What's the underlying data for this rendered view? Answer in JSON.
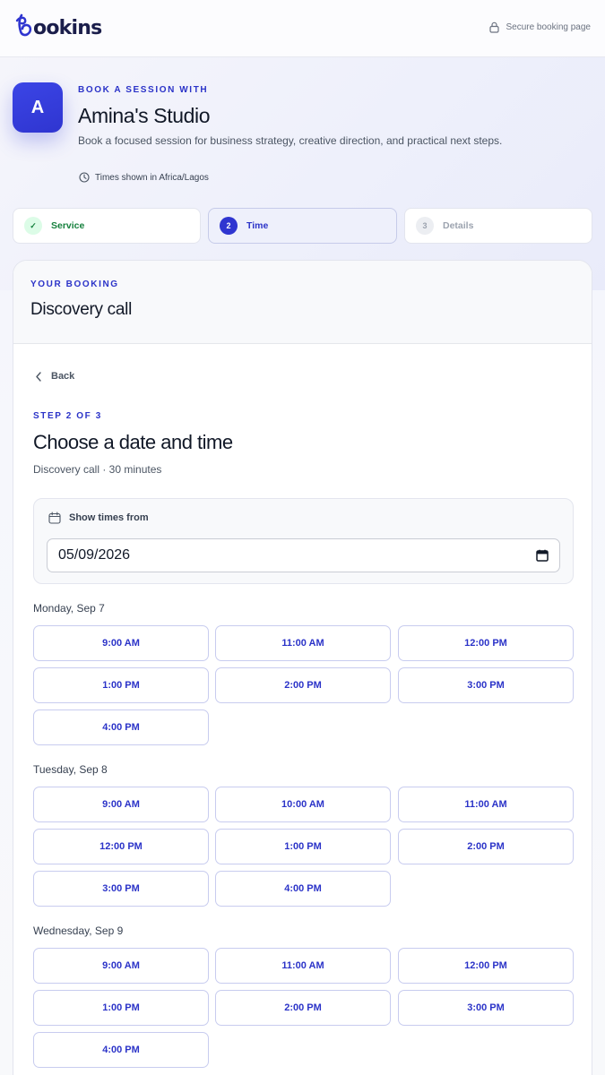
{
  "header": {
    "brand": "ookins",
    "secure_label": "Secure booking page"
  },
  "hero": {
    "avatar_letter": "A",
    "eyebrow": "BOOK A SESSION WITH",
    "studio_name": "Amina's Studio",
    "description": "Book a focused session for business strategy, creative direction, and practical next steps.",
    "timezone_label": "Times shown in Africa/Lagos"
  },
  "stepper": [
    {
      "marker": "✓",
      "label": "Service",
      "state": "done"
    },
    {
      "marker": "2",
      "label": "Time",
      "state": "current"
    },
    {
      "marker": "3",
      "label": "Details",
      "state": "upcoming"
    }
  ],
  "booking": {
    "eyebrow": "YOUR BOOKING",
    "service": "Discovery call"
  },
  "main": {
    "back_label": "Back",
    "step_indicator": "STEP 2 OF 3",
    "title": "Choose a date and time",
    "subtitle": "Discovery call · 30 minutes",
    "date_filter": {
      "label": "Show times from",
      "value": "05/09/2026"
    }
  },
  "days": [
    {
      "label": "Monday, Sep 7",
      "slots": [
        "9:00 AM",
        "11:00 AM",
        "12:00 PM",
        "1:00 PM",
        "2:00 PM",
        "3:00 PM",
        "4:00 PM"
      ]
    },
    {
      "label": "Tuesday, Sep 8",
      "slots": [
        "9:00 AM",
        "10:00 AM",
        "11:00 AM",
        "12:00 PM",
        "1:00 PM",
        "2:00 PM",
        "3:00 PM",
        "4:00 PM"
      ]
    },
    {
      "label": "Wednesday, Sep 9",
      "slots": [
        "9:00 AM",
        "11:00 AM",
        "12:00 PM",
        "1:00 PM",
        "2:00 PM",
        "3:00 PM",
        "4:00 PM"
      ]
    }
  ],
  "colors": {
    "accent": "#2f35d0",
    "success": "#15803d",
    "slot_border": "#c8ccef"
  }
}
